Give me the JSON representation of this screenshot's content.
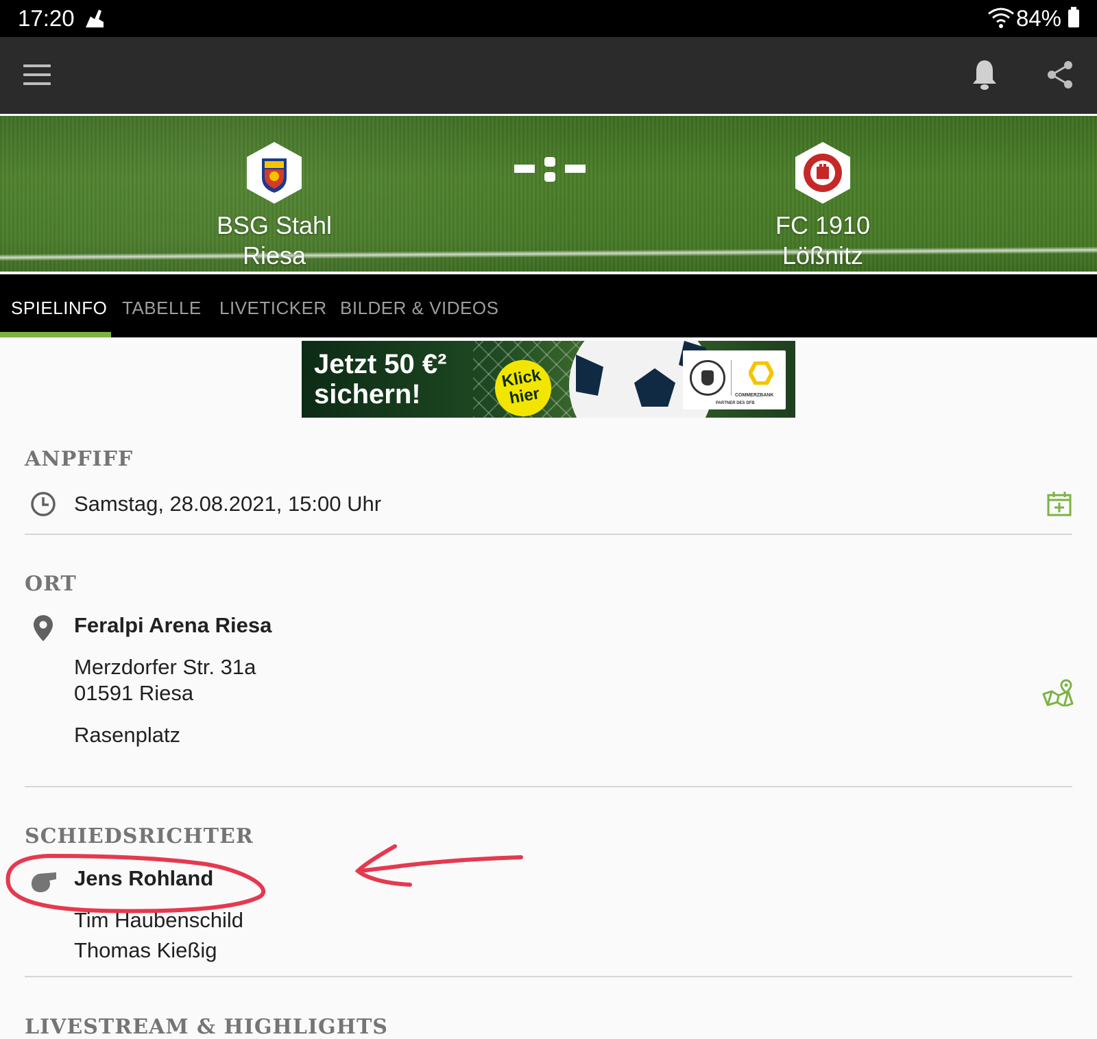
{
  "status_bar": {
    "time": "17:20",
    "battery": "84%",
    "icons": [
      "notification-icon",
      "wifi-icon",
      "battery-icon"
    ]
  },
  "app_bar": {
    "icons": [
      "menu-icon",
      "bell-icon",
      "share-icon"
    ]
  },
  "match": {
    "home_team": "BSG Stahl\nRiesa",
    "away_team": "FC 1910\nLößnitz",
    "score": "-:-"
  },
  "tabs": [
    {
      "label": "SPIELINFO",
      "active": true
    },
    {
      "label": "TABELLE",
      "active": false
    },
    {
      "label": "LIVETICKER",
      "active": false
    },
    {
      "label": "BILDER & VIDEOS",
      "active": false
    }
  ],
  "ad": {
    "headline": "Jetzt 50 €²\nsichern!",
    "cta": "Klick\nhier",
    "sponsor": "COMMERZBANK",
    "partner": "PARTNER DES DFB"
  },
  "sections": {
    "anpfiff": {
      "title": "ANPFIFF",
      "datetime": "Samstag, 28.08.2021, 15:00 Uhr"
    },
    "ort": {
      "title": "ORT",
      "venue": "Feralpi Arena Riesa",
      "street": "Merzdorfer Str. 31a",
      "city": "01591 Riesa",
      "surface": "Rasenplatz"
    },
    "schiedsrichter": {
      "title": "SCHIEDSRICHTER",
      "referee": "Jens Rohland",
      "assistant_1": "Tim Haubenschild",
      "assistant_2": "Thomas Kießig"
    },
    "livestream": {
      "title": "LIVESTREAM & HIGHLIGHTS"
    }
  },
  "colors": {
    "accent": "#7cb342",
    "app_bar": "#2b2b2b",
    "status_bar": "#000000",
    "annotation": "#e53950"
  }
}
